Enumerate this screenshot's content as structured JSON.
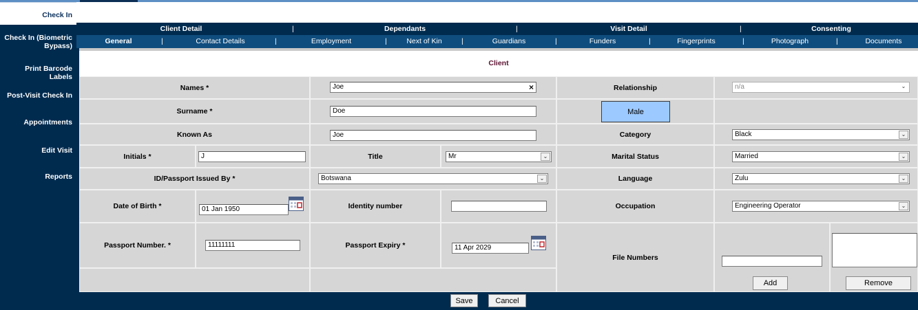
{
  "sidebar": {
    "items": [
      {
        "label": "Check In"
      },
      {
        "label": "Check In (Biometric"
      },
      {
        "label": "Bypass)"
      },
      {
        "label": "Print Barcode Labels"
      },
      {
        "label": "Post-Visit Check In"
      },
      {
        "label": "Appointments"
      },
      {
        "label": "Edit Visit"
      },
      {
        "label": "Reports"
      }
    ]
  },
  "tabs_primary": [
    "Client Detail",
    "Dependants",
    "Visit Detail",
    "Consenting"
  ],
  "tabs_secondary": [
    "General",
    "Contact Details",
    "Employment",
    "Next of Kin",
    "Guardians",
    "Funders",
    "Fingerprints",
    "Photograph",
    "Documents"
  ],
  "separator": "|",
  "section_title": "Client",
  "form": {
    "names": {
      "label": "Names *",
      "value": "Joe",
      "clear_glyph": "×"
    },
    "relationship": {
      "label": "Relationship",
      "value": "n/a"
    },
    "surname": {
      "label": "Surname *",
      "value": "Doe"
    },
    "gender_button": "Male",
    "known_as": {
      "label": "Known As",
      "value": "Joe"
    },
    "category": {
      "label": "Category",
      "value": "Black"
    },
    "initials": {
      "label": "Initials *",
      "value": "J"
    },
    "title": {
      "label": "Title",
      "value": "Mr"
    },
    "marital_status": {
      "label": "Marital Status",
      "value": "Married"
    },
    "id_issued_by": {
      "label": "ID/Passport Issued By *",
      "value": "Botswana"
    },
    "language": {
      "label": "Language",
      "value": "Zulu"
    },
    "dob": {
      "label": "Date of Birth *",
      "value": "01 Jan 1950"
    },
    "identity_number": {
      "label": "Identity number",
      "value": ""
    },
    "occupation": {
      "label": "Occupation",
      "value": "Engineering Operator"
    },
    "passport_number": {
      "label": "Passport Number. *",
      "value": "11111111"
    },
    "passport_expiry": {
      "label": "Passport Expiry *",
      "value": "11 Apr 2029"
    },
    "file_numbers": {
      "label": "File Numbers",
      "input_value": "",
      "list_value": ""
    },
    "add_button": "Add",
    "remove_button": "Remove"
  },
  "footer": {
    "save": "Save",
    "cancel": "Cancel"
  },
  "colors": {
    "navy": "#002b4f",
    "tab2": "#0f4d7e",
    "male_button": "#9cc9ff",
    "section_title": "#5a1230"
  }
}
